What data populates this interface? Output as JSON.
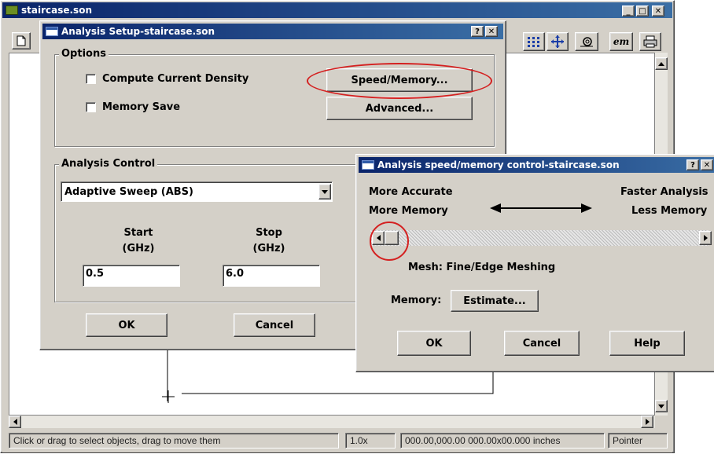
{
  "main_window": {
    "title": "staircase.son",
    "min": "_",
    "max": "□",
    "close": "✕",
    "toolbar_em": "em"
  },
  "status_bar": {
    "hint": "Click or drag to select objects, drag to move them",
    "zoom": "1.0x",
    "coords": "000.00,000.00 000.00x00.000 inches",
    "mode": "Pointer"
  },
  "setup_dialog": {
    "title": "Analysis Setup-staircase.son",
    "help": "?",
    "close": "✕",
    "options_legend": "Options",
    "compute_current_density": "Compute Current Density",
    "memory_save": "Memory Save",
    "speed_memory_button": "Speed/Memory...",
    "advanced_button": "Advanced...",
    "analysis_control_legend": "Analysis Control",
    "sweep_select_value": "Adaptive Sweep (ABS)",
    "start_label": "Start",
    "start_unit": "(GHz)",
    "stop_label": "Stop",
    "stop_unit": "(GHz)",
    "start_value": "0.5",
    "stop_value": "6.0",
    "ok_button": "OK",
    "cancel_button": "Cancel"
  },
  "speed_dialog": {
    "title": "Analysis speed/memory control-staircase.son",
    "help": "?",
    "close": "✕",
    "more_accurate": "More Accurate",
    "more_memory": "More Memory",
    "faster_analysis": "Faster Analysis",
    "less_memory": "Less Memory",
    "slider_level": 0,
    "mesh_label": "Mesh: Fine/Edge Meshing",
    "memory_label": "Memory:",
    "estimate_button": "Estimate...",
    "ok_button": "OK",
    "cancel_button": "Cancel",
    "help_button": "Help"
  },
  "colors": {
    "face": "#d4d0c8",
    "title_start": "#0a246a",
    "title_end": "#3a6ea5",
    "annotation": "#d42020"
  }
}
